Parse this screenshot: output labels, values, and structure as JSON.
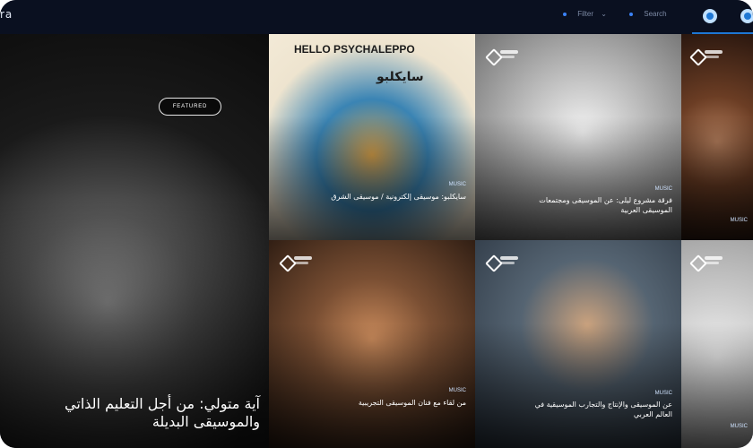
{
  "topbar": {
    "logo_fragment": "ra",
    "nav": [
      {
        "label": "Filter"
      },
      {
        "label": "Search"
      }
    ]
  },
  "hero": {
    "badge": "FEATURED",
    "title_line1": "آية متولي: من أجل التعليم الذاتي",
    "title_line2": "والموسيقى البديلة"
  },
  "tiles": [
    {
      "art_title_en": "HELLO PSYCHALEPPO",
      "art_title_ar": "سايكلبو",
      "kicker": "MUSIC",
      "caption": "سايكلبو: موسيقى إلكترونية / موسيقى الشرق"
    },
    {
      "kicker": "MUSIC",
      "caption": "فرقة مشروع ليلى: عن الموسيقى ومجتمعات الموسيقى العربية"
    },
    {
      "kicker": "MUSIC",
      "caption": ""
    },
    {
      "kicker": "MUSIC",
      "caption": "من لقاء مع فنان الموسيقى التجريبية"
    },
    {
      "kicker": "MUSIC",
      "caption": "عن الموسيقى والإنتاج والتجارب الموسيقية في العالم العربي"
    },
    {
      "kicker": "MUSIC",
      "caption": ""
    }
  ],
  "colors": {
    "bar": "#0a1020",
    "accent": "#1e77d4"
  }
}
